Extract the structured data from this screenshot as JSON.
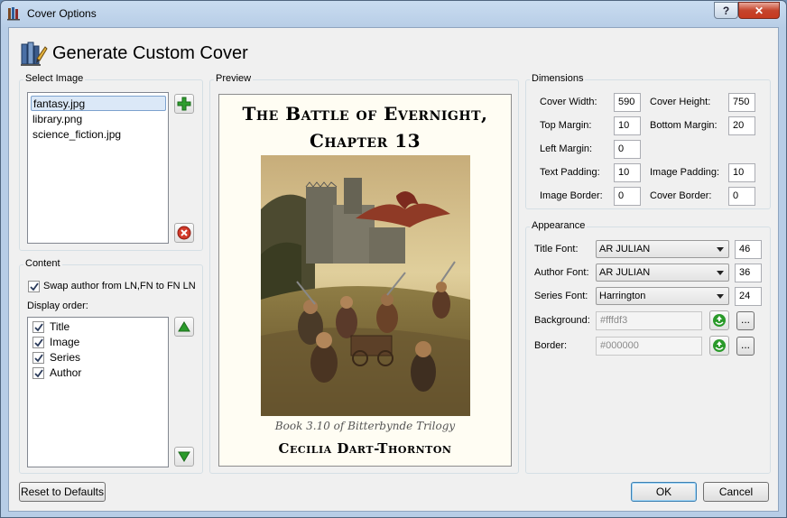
{
  "window": {
    "title": "Cover Options",
    "help_label": "?",
    "close_label": "✕"
  },
  "header": {
    "title": "Generate Custom Cover",
    "icon": "books-paint-icon"
  },
  "select_image": {
    "label": "Select Image",
    "files": [
      "fantasy.jpg",
      "library.png",
      "science_fiction.jpg"
    ],
    "selected": "fantasy.jpg"
  },
  "content": {
    "label": "Content",
    "swap_label": "Swap author from LN,FN to FN LN",
    "swap_checked": true,
    "display_order_label": "Display order:",
    "order_items": [
      "Title",
      "Image",
      "Series",
      "Author"
    ]
  },
  "preview": {
    "label": "Preview",
    "title_line1": "The Battle of Evernight,",
    "title_line2": "Chapter 13",
    "series_text": "Book 3.10 of Bitterbynde Trilogy",
    "author_text": "Cecilia Dart-Thornton"
  },
  "dimensions": {
    "label": "Dimensions",
    "cover_width_label": "Cover Width:",
    "cover_width": "590",
    "cover_height_label": "Cover Height:",
    "cover_height": "750",
    "top_margin_label": "Top Margin:",
    "top_margin": "10",
    "bottom_margin_label": "Bottom Margin:",
    "bottom_margin": "20",
    "left_margin_label": "Left Margin:",
    "left_margin": "0",
    "text_padding_label": "Text Padding:",
    "text_padding": "10",
    "image_padding_label": "Image Padding:",
    "image_padding": "10",
    "image_border_label": "Image Border:",
    "image_border": "0",
    "cover_border_label": "Cover Border:",
    "cover_border": "0"
  },
  "appearance": {
    "label": "Appearance",
    "title_font_label": "Title Font:",
    "title_font": "AR JULIAN",
    "title_size": "46",
    "author_font_label": "Author Font:",
    "author_font": "AR JULIAN",
    "author_size": "36",
    "series_font_label": "Series Font:",
    "series_font": "Harrington",
    "series_size": "24",
    "background_label": "Background:",
    "background_value": "#fffdf3",
    "border_label": "Border:",
    "border_value": "#000000",
    "browse_label": "..."
  },
  "buttons": {
    "reset": "Reset to Defaults",
    "ok": "OK",
    "cancel": "Cancel"
  },
  "colors": {
    "cover_background": "#fffdf3",
    "accent_green": "#2a9a2a",
    "accent_red": "#d23a2a"
  }
}
